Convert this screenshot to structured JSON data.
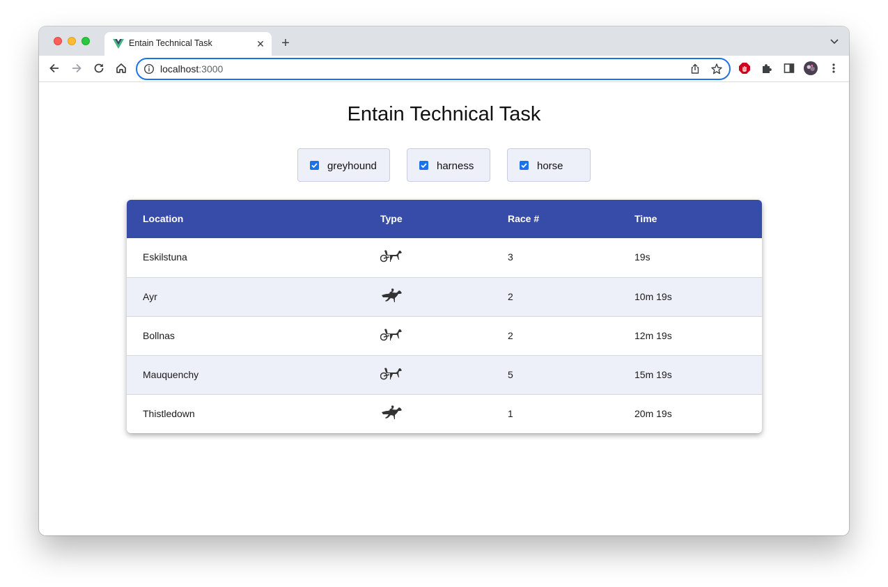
{
  "browser": {
    "tab_title": "Entain Technical Task",
    "tab_close_icon": "close-icon",
    "new_tab_icon": "plus-icon",
    "url_host": "localhost",
    "url_port": ":3000"
  },
  "page": {
    "title": "Entain Technical Task"
  },
  "filters": [
    {
      "label": "greyhound",
      "checked": true
    },
    {
      "label": "harness",
      "checked": true
    },
    {
      "label": "horse",
      "checked": true
    }
  ],
  "table": {
    "headers": [
      "Location",
      "Type",
      "Race #",
      "Time"
    ],
    "rows": [
      {
        "location": "Eskilstuna",
        "type": "harness",
        "race": "3",
        "time": "19s"
      },
      {
        "location": "Ayr",
        "type": "horse",
        "race": "2",
        "time": "10m 19s"
      },
      {
        "location": "Bollnas",
        "type": "harness",
        "race": "2",
        "time": "12m 19s"
      },
      {
        "location": "Mauquenchy",
        "type": "harness",
        "race": "5",
        "time": "15m 19s"
      },
      {
        "location": "Thistledown",
        "type": "horse",
        "race": "1",
        "time": "20m 19s"
      }
    ]
  },
  "colors": {
    "header_bg": "#374ca8",
    "alt_row_bg": "#eef0f9",
    "checkbox": "#1a73e8",
    "accent_focus": "#1a73e8"
  }
}
